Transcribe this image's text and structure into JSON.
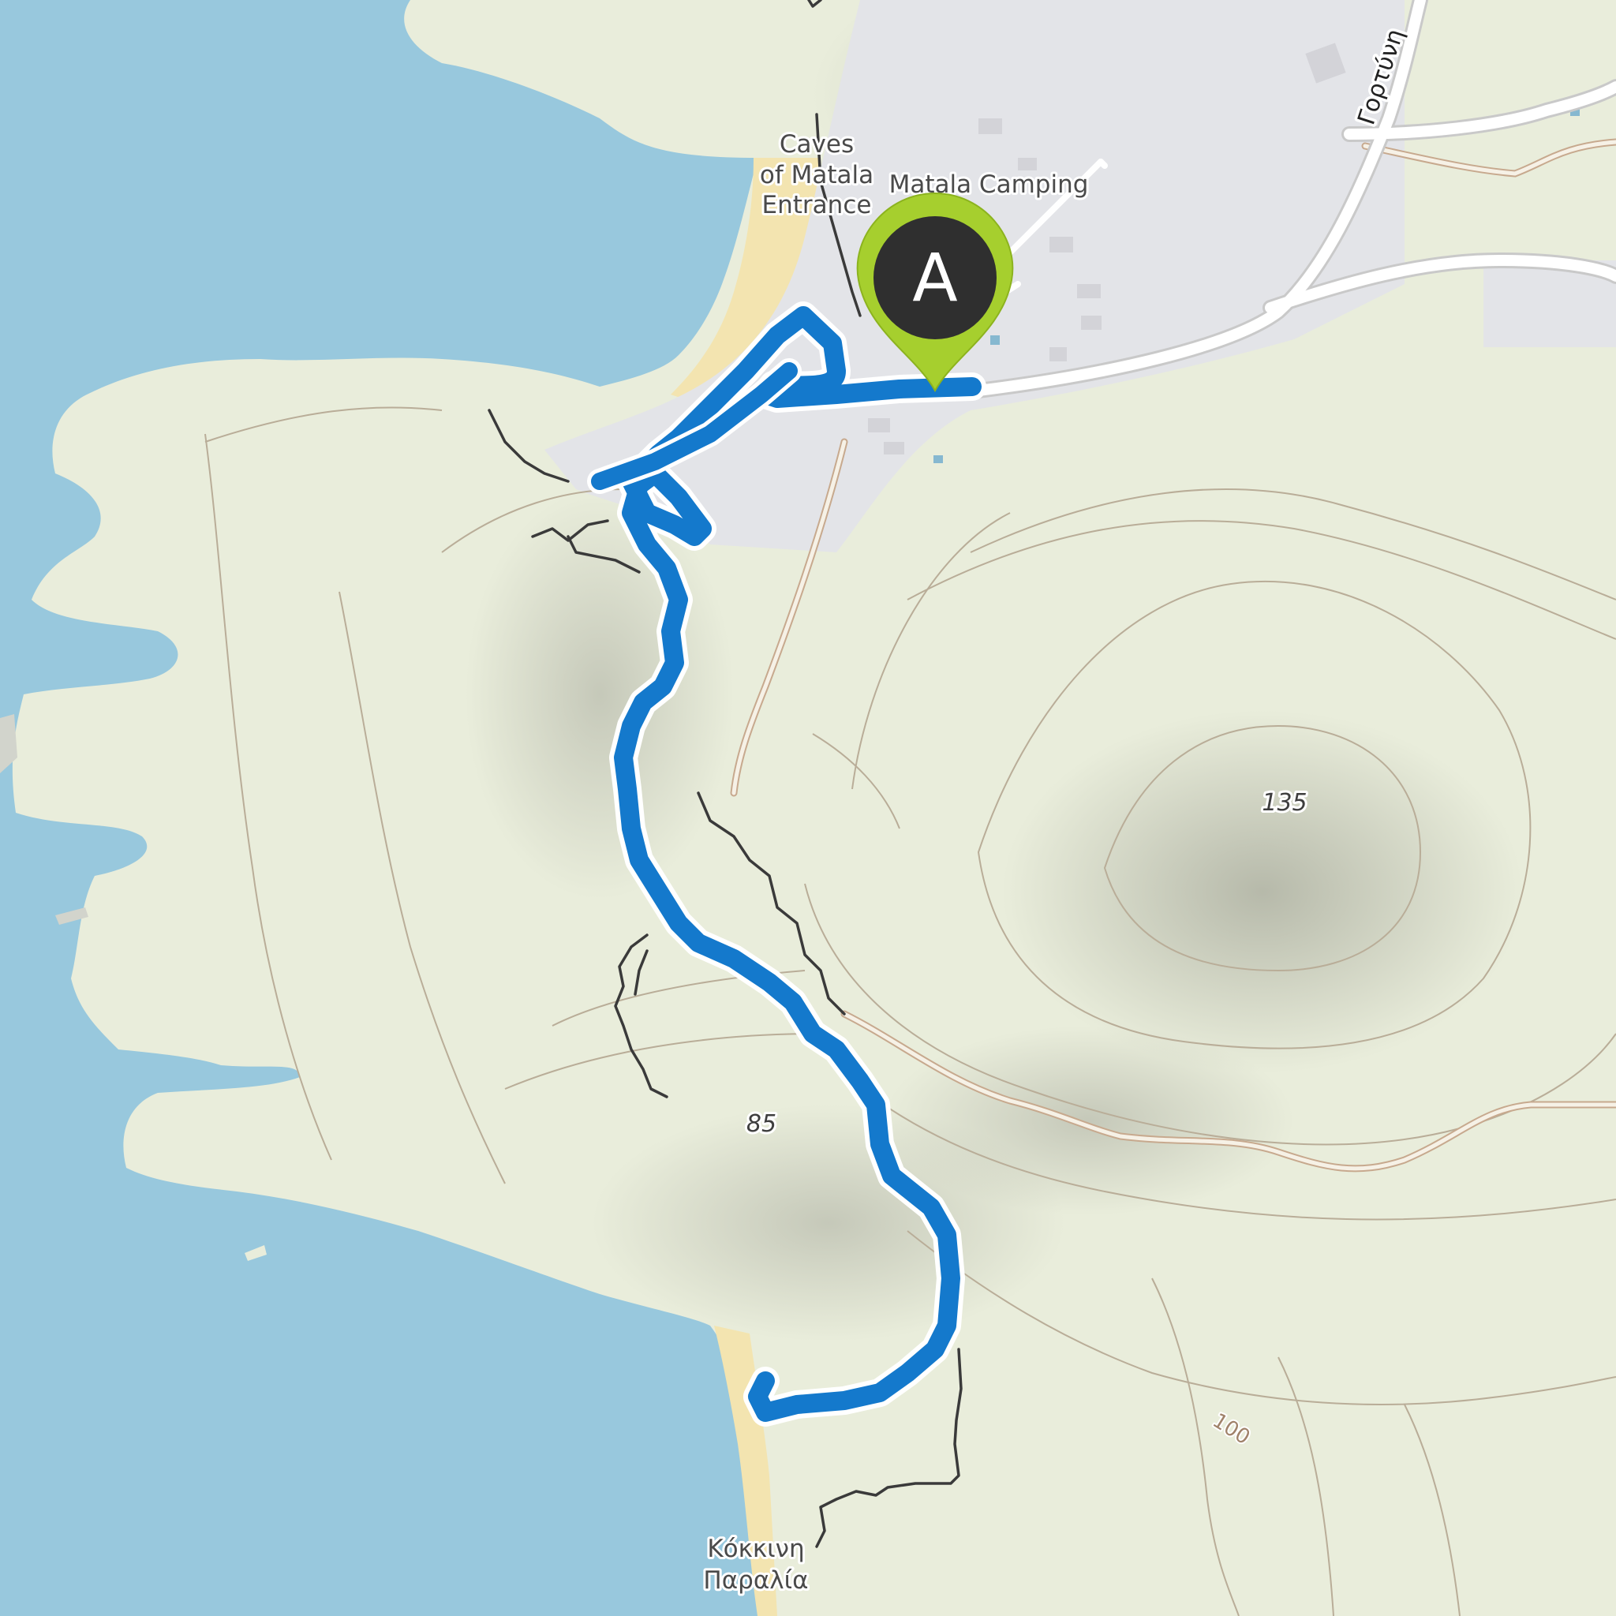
{
  "map": {
    "colors": {
      "water": "#98c8dd",
      "land": "#e9eddb",
      "settlement": "#e3e4e8",
      "beach": "#f3e4b0",
      "contour": "#b9ad98",
      "footpath": "#3a3a3a",
      "track": "#c7a98e",
      "road": "#ffffff",
      "route": "#1479cc",
      "marker_fill": "#2f2f2f",
      "marker_ring": "#a6cf2e"
    },
    "labels": {
      "caves_line1": "Caves",
      "caves_line2": "of Matala",
      "caves_line3": "Entrance",
      "camping": "Matala Camping",
      "road_name": "Γορτύνη",
      "elev_135": "135",
      "elev_85": "85",
      "contour_100": "100",
      "beach_line1": "Κόκκινη",
      "beach_line2": "Παραλία"
    },
    "start_marker": {
      "label": "A",
      "icon": "map-pin-marker"
    },
    "route": {
      "type": "hiking-track",
      "shape": "out-and-back loop from Matala to Kokkini Paralia"
    }
  }
}
